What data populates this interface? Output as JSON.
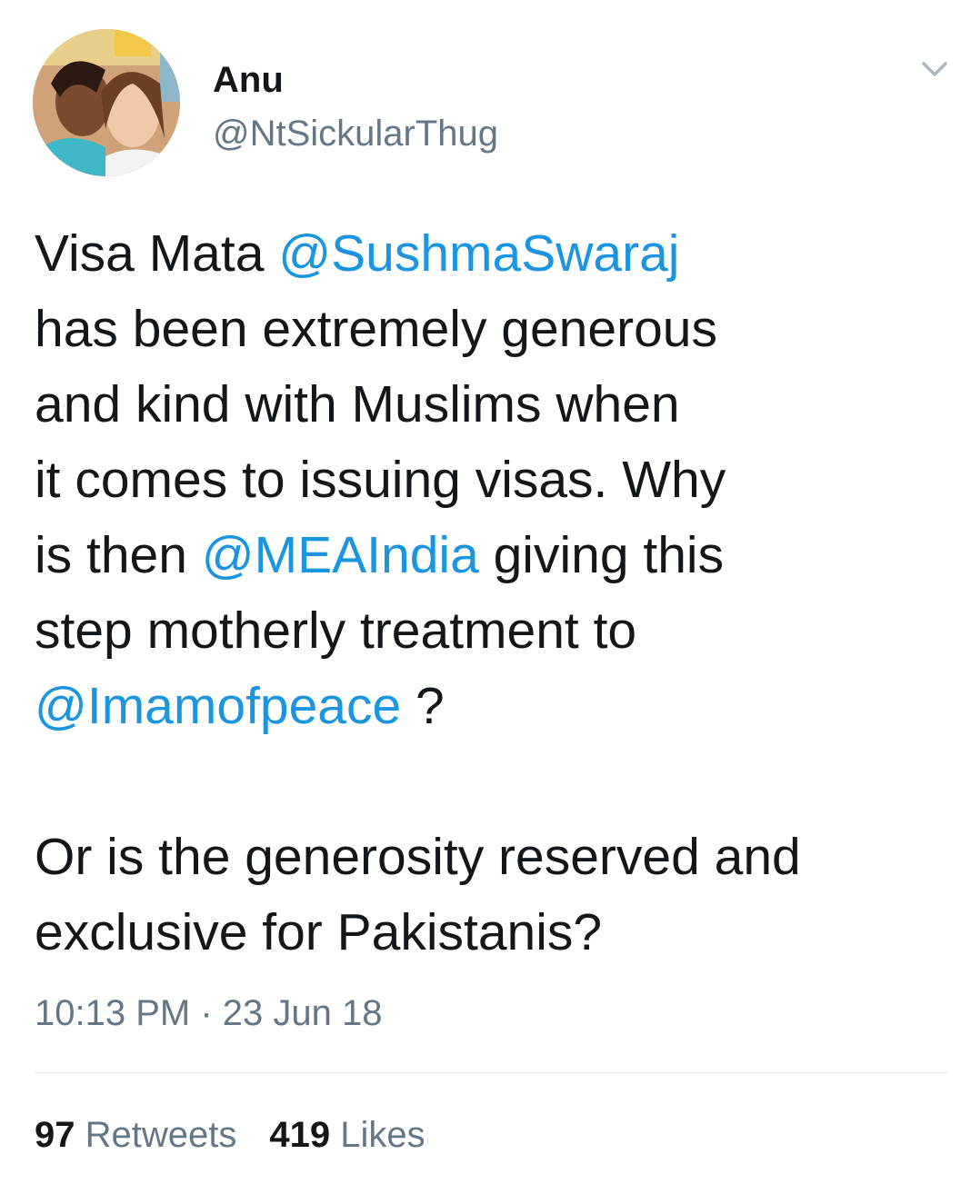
{
  "author": {
    "display_name": "Anu",
    "handle": "@NtSickularThug",
    "avatar_icon": "avatar-photo"
  },
  "tweet": {
    "segments": [
      {
        "type": "text",
        "value": "Visa Mata "
      },
      {
        "type": "mention",
        "value": "@SushmaSwaraj"
      },
      {
        "type": "text",
        "value": " has been extremely generous and kind with Muslims when it comes to issuing visas. Why is then "
      },
      {
        "type": "mention",
        "value": "@MEAIndia"
      },
      {
        "type": "text",
        "value": " giving this step motherly treatment to "
      },
      {
        "type": "mention",
        "value": "@Imamofpeace"
      },
      {
        "type": "text",
        "value": " ?"
      }
    ],
    "line1_a": "Visa Mata ",
    "mention1": "@SushmaSwaraj",
    "line2": "has been extremely generous",
    "line3": "and kind with Muslims when",
    "line4": "it comes to issuing visas. Why",
    "line5_a": "is then ",
    "mention2": "@MEAIndia",
    "line5_b": " giving this",
    "line6": "step motherly treatment to",
    "mention3": "@Imamofpeace",
    "line7_b": " ?",
    "paragraph2_line1": "Or is the generosity reserved and",
    "paragraph2_line2": "exclusive for Pakistanis?",
    "timestamp": "10:13 PM · 23 Jun 18"
  },
  "stats": {
    "retweets_count": "97",
    "retweets_label": "Retweets",
    "likes_count": "419",
    "likes_label": "Likes"
  },
  "icons": {
    "caret": "chevron-down-icon"
  },
  "colors": {
    "mention": "#1b95e0",
    "secondary_text": "#657786",
    "primary_text": "#14171a",
    "divider": "#e1e8ed"
  }
}
